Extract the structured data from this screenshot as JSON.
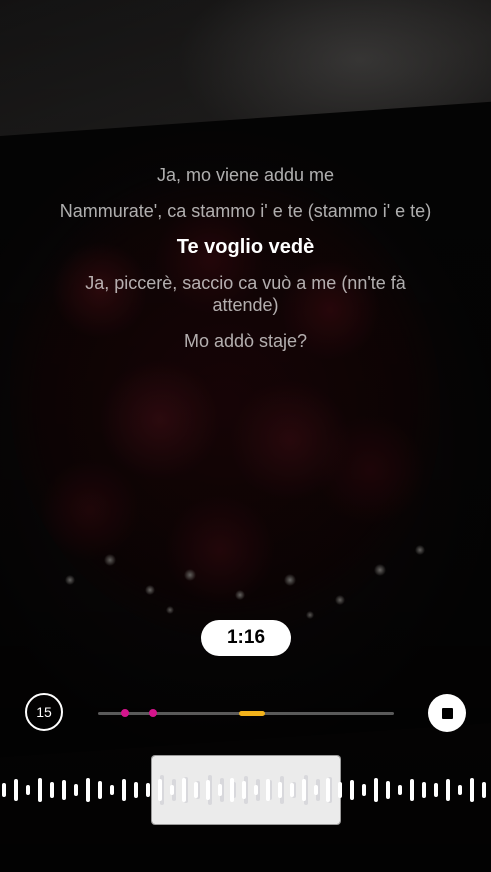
{
  "lyrics": {
    "lines": [
      "Ja, mo viene addu me",
      "Nammurate', ca stammo i' e te (stammo i' e te)",
      "Te voglio vedè",
      "Ja, piccerè, saccio ca vuò a me (nn'te fà attende)",
      "Mo addò staje?"
    ],
    "current_index": 2
  },
  "playback": {
    "current_time": "1:16",
    "skip_back_label": "15",
    "progress_markers_fraction": [
      0.09,
      0.187
    ],
    "current_segment_fraction": [
      0.477,
      0.565
    ]
  },
  "colors": {
    "accent_marker": "#d4148c",
    "current_segment": "#f3b21b"
  },
  "icons": {
    "skip_back": "skip-back-15-icon",
    "stop": "stop-icon"
  }
}
